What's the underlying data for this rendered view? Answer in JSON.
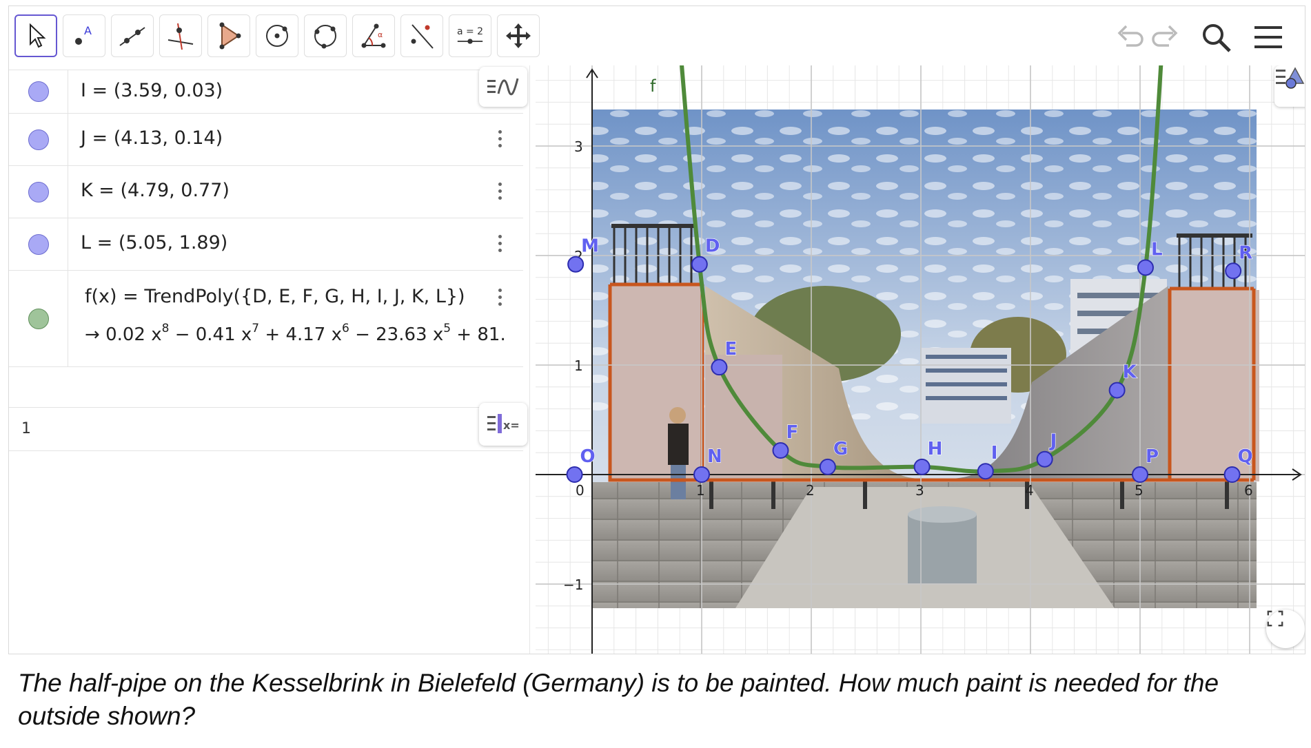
{
  "toolbar": {
    "tools": [
      {
        "name": "move-tool",
        "label": ""
      },
      {
        "name": "point-tool",
        "label": ""
      },
      {
        "name": "line-tool",
        "label": ""
      },
      {
        "name": "perpendicular-line-tool",
        "label": ""
      },
      {
        "name": "polygon-tool",
        "label": ""
      },
      {
        "name": "circle-center-point-tool",
        "label": ""
      },
      {
        "name": "circle-three-points-tool",
        "label": ""
      },
      {
        "name": "angle-tool",
        "label": ""
      },
      {
        "name": "reflect-line-tool",
        "label": ""
      },
      {
        "name": "slider-tool",
        "label": "a = 2"
      },
      {
        "name": "move-graphics-tool",
        "label": ""
      }
    ],
    "right_icons": [
      "undo-icon",
      "redo-icon",
      "search-icon",
      "menu-icon"
    ]
  },
  "algebra": {
    "rows": [
      {
        "label": "I = (3.59, 0.03)",
        "color": "#a9a9f5"
      },
      {
        "label": "J = (4.13, 0.14)",
        "color": "#a9a9f5"
      },
      {
        "label": "K = (4.79, 0.77)",
        "color": "#a9a9f5"
      },
      {
        "label": "L = (5.05, 1.89)",
        "color": "#a9a9f5"
      }
    ],
    "function": {
      "definition": "f(x)  =  TrendPoly({D, E, F, G, H, I, J, K, L})",
      "result_prefix": "→",
      "result_terms": [
        {
          "text": "0.02 x",
          "exp": "8"
        },
        {
          "text": " − 0.41 x",
          "exp": "7"
        },
        {
          "text": " + 4.17 x",
          "exp": "6"
        },
        {
          "text": " − 23.63 x",
          "exp": "5"
        },
        {
          "text": " + 81.",
          "exp": ""
        }
      ],
      "color": "#9fc49a"
    },
    "input_number": "1"
  },
  "graphics": {
    "axis_ticks_x": [
      "0",
      "1",
      "2",
      "3",
      "4",
      "5",
      "6"
    ],
    "axis_ticks_y": [
      "3",
      "2",
      "1",
      "−1"
    ],
    "function_label": "f",
    "points": [
      {
        "name": "M",
        "x": -0.15,
        "y": 1.92
      },
      {
        "name": "D",
        "x": 0.98,
        "y": 1.92
      },
      {
        "name": "E",
        "x": 1.16,
        "y": 0.98
      },
      {
        "name": "F",
        "x": 1.72,
        "y": 0.22
      },
      {
        "name": "G",
        "x": 2.15,
        "y": 0.07
      },
      {
        "name": "H",
        "x": 3.01,
        "y": 0.07
      },
      {
        "name": "I",
        "x": 3.59,
        "y": 0.03
      },
      {
        "name": "J",
        "x": 4.13,
        "y": 0.14
      },
      {
        "name": "K",
        "x": 4.79,
        "y": 0.77
      },
      {
        "name": "L",
        "x": 5.05,
        "y": 1.89
      },
      {
        "name": "R",
        "x": 5.85,
        "y": 1.86
      },
      {
        "name": "O",
        "x": -0.16,
        "y": 0.0
      },
      {
        "name": "N",
        "x": 1.0,
        "y": 0.0
      },
      {
        "name": "P",
        "x": 5.0,
        "y": 0.0
      },
      {
        "name": "Q",
        "x": 5.84,
        "y": 0.0
      }
    ],
    "colors": {
      "point": "#7272f0",
      "curve": "#4f8a3a",
      "frame": "#c8561e"
    }
  },
  "caption": "The half-pipe on the Kesselbrink in Bielefeld (Germany) is to be painted. How much paint is needed for the outside shown?"
}
